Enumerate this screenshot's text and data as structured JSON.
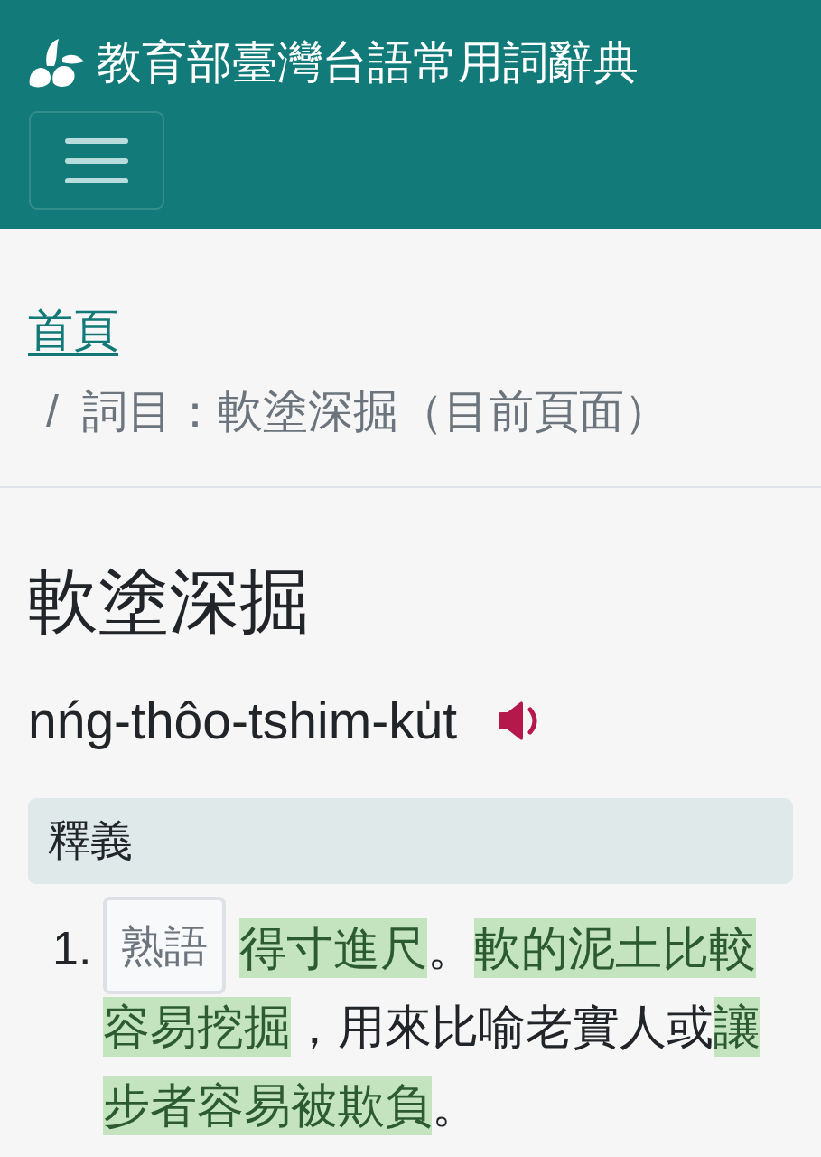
{
  "header": {
    "title": "教育部臺灣台語常用詞辭典"
  },
  "breadcrumb": [
    {
      "label": "首頁",
      "current": false
    },
    {
      "separator": "/",
      "label": "詞目：軟塗深掘（目前頁面）",
      "current": true
    }
  ],
  "entry": {
    "title": "軟塗深掘",
    "romanization": "nńg-thôo-tshim-ku̍t"
  },
  "section": {
    "title": "釋義"
  },
  "definitions": [
    {
      "number": "1.",
      "tag": "熟語",
      "segments": [
        {
          "text": "得寸進尺",
          "highlighted": true
        },
        {
          "text": "。",
          "highlighted": false
        },
        {
          "text": "軟的泥土比較容易挖掘",
          "highlighted": true
        },
        {
          "text": "，用來比喻老實人或",
          "highlighted": false
        },
        {
          "text": "讓步者容易被欺負",
          "highlighted": true
        },
        {
          "text": "。",
          "highlighted": false
        }
      ]
    }
  ]
}
